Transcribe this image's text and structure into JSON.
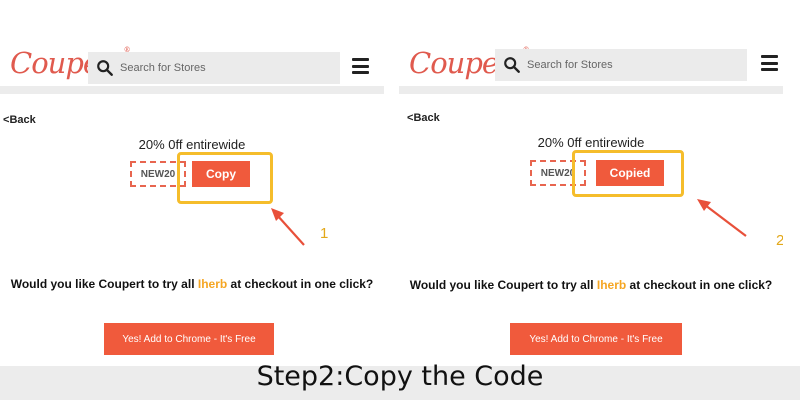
{
  "colors": {
    "brand": "#e05a4e",
    "button": "#f05a3c",
    "highlight": "#f5bd2b",
    "step_number": "#e3a81a",
    "brand_text": "#f5a623"
  },
  "panels": [
    {
      "logo": "Coupert",
      "logo_mark": "®",
      "search_placeholder": "Search for Stores",
      "back_label": "Back",
      "offer_title": "20% 0ff entirewide",
      "code": "NEW20",
      "copy_button_label": "Copy",
      "step_number": "1",
      "question_before": "Would you like Coupert to try all ",
      "question_brand": "Iherb",
      "question_after": " at checkout in one click?",
      "cta_label": "Yes! Add to Chrome - It's Free"
    },
    {
      "logo": "Coupert",
      "logo_mark": "®",
      "search_placeholder": "Search for Stores",
      "back_label": "Back",
      "offer_title": "20% 0ff entirewide",
      "code": "NEW20",
      "copy_button_label": "Copied",
      "step_number": "2",
      "question_before": "Would you like Coupert to try all ",
      "question_brand": "Iherb",
      "question_after": " at checkout in one click?",
      "cta_label": "Yes! Add to Chrome - It's Free"
    }
  ],
  "caption": "Step2:Copy the Code"
}
